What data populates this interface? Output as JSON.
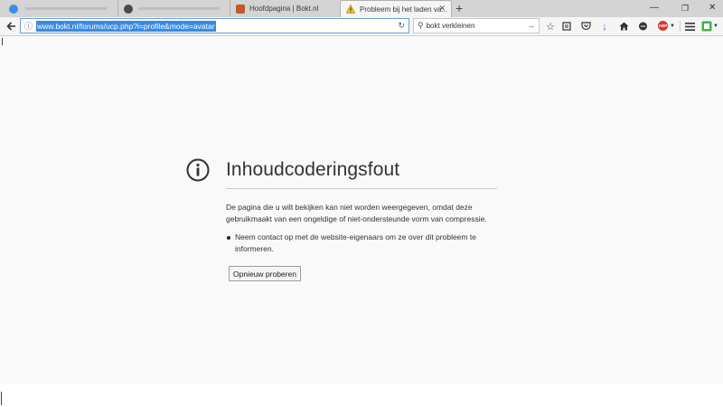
{
  "tabs": [
    {
      "label": "",
      "style": "inactive",
      "favicon_color": "#3a8ee6"
    },
    {
      "label": "",
      "style": "inactive",
      "favicon_color": "#4a4a4a"
    },
    {
      "label": "Hoofdpagina | Bokt.nl",
      "style": "background",
      "favicon_color": "#c05a2a"
    },
    {
      "label": "Probleem bij het laden va...",
      "style": "active",
      "favicon": "warning-icon"
    }
  ],
  "toolbar": {
    "url": "www.bokt.nl/forums/ucp.php?i=profile&mode=avatar",
    "search_value": "bokt verkleinen"
  },
  "error": {
    "title": "Inhoudcoderingsfout",
    "description": "De pagina die u wilt bekijken kan niet worden weergegeven, omdat deze gebruikmaakt van een ongeldige of niet-ondersteunde vorm van compressie.",
    "bullets": [
      "Neem contact op met de website-eigenaars om ze over dit probleem te informeren."
    ],
    "retry_label": "Opnieuw proberen"
  },
  "colors": {
    "accent": "#3b8ae0",
    "abp_red": "#d73a32",
    "pocket_red": "#e0344f",
    "download_blue": "#2a7fd4",
    "addon_green": "#3bb54a"
  },
  "icons": {
    "back": "back-arrow-icon",
    "info": "info-icon",
    "reload": "reload-icon",
    "search": "search-icon",
    "go": "go-arrow-icon",
    "bookmark": "bookmark-star-icon",
    "reading_list": "reading-list-icon",
    "pocket": "pocket-icon",
    "download": "download-icon",
    "home": "home-icon",
    "chat": "chat-icon",
    "adblock": "adblock-plus-icon",
    "menu": "hamburger-menu-icon",
    "addon": "addon-icon",
    "error": "error-info-icon"
  }
}
